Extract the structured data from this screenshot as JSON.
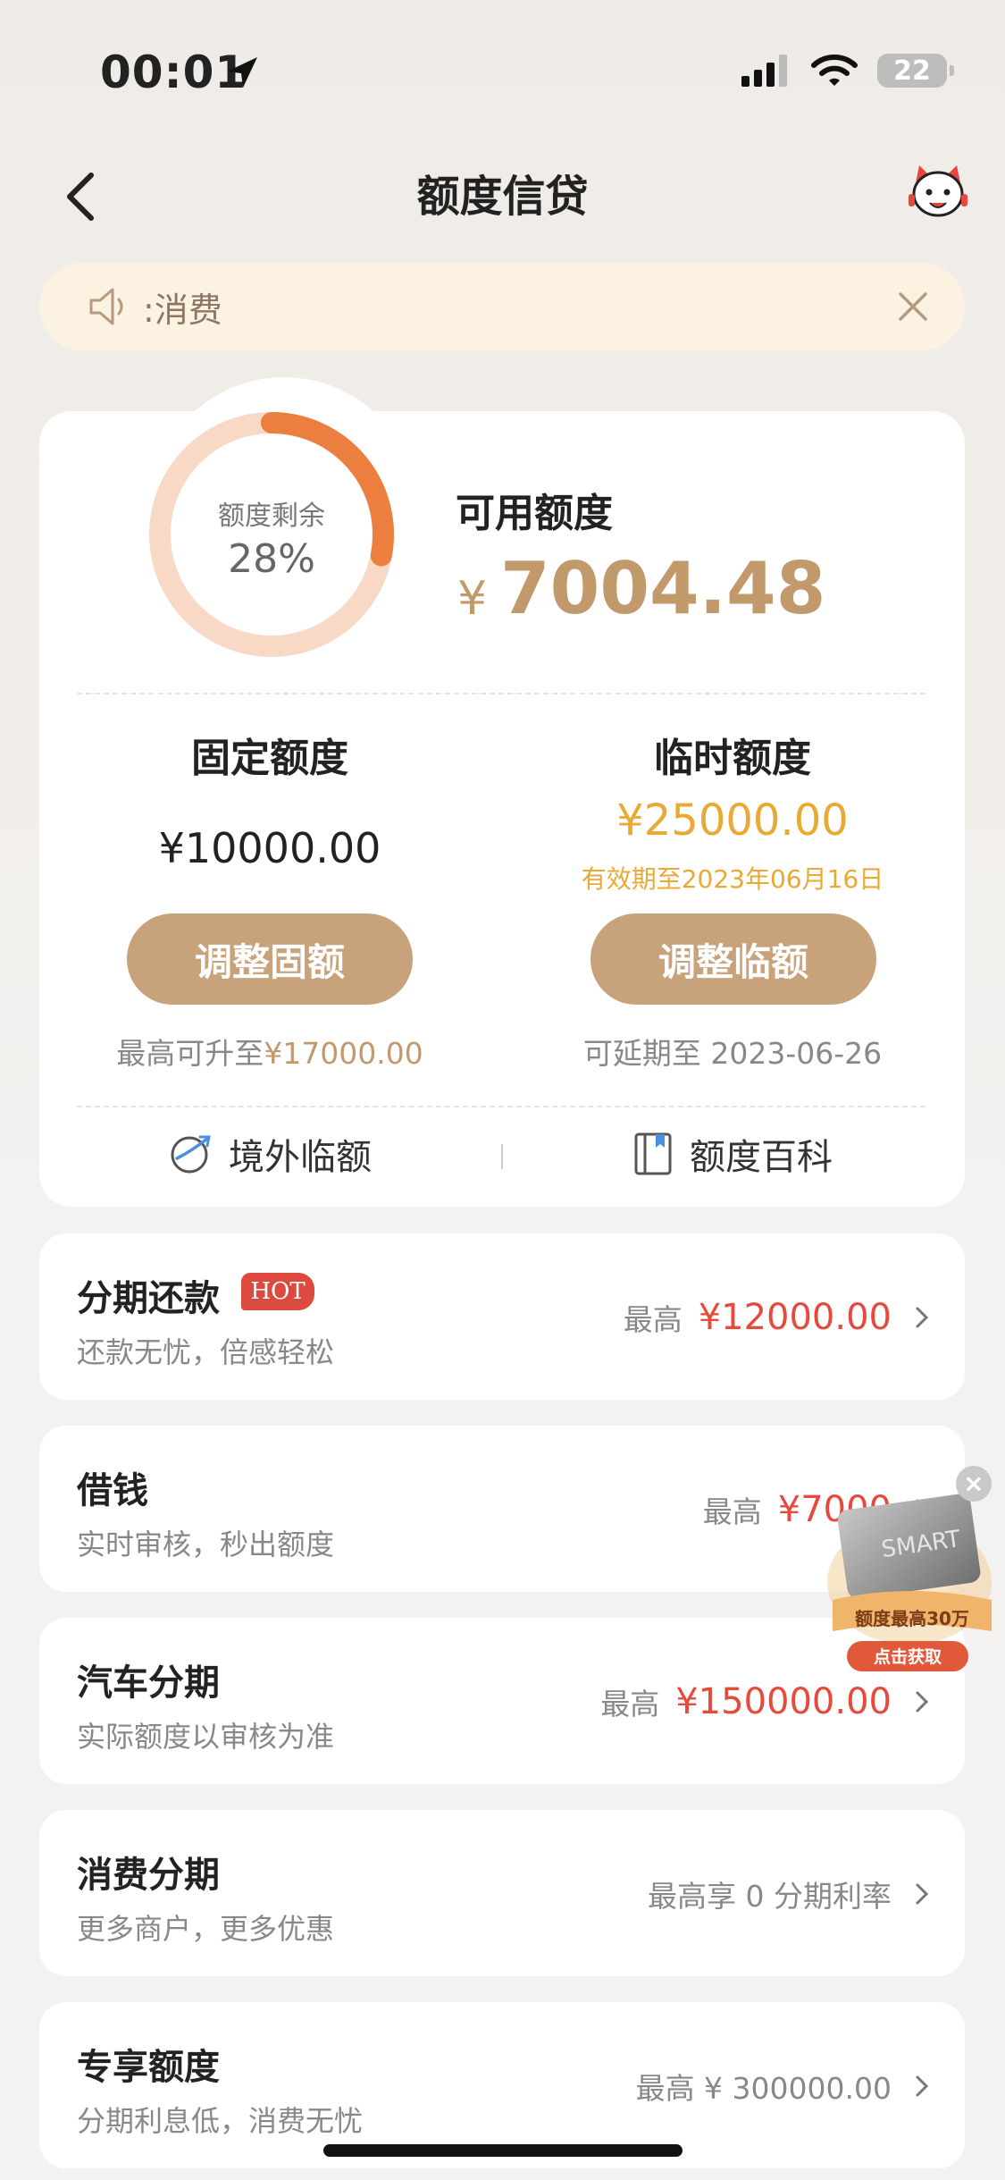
{
  "status_bar": {
    "time": "00:01",
    "battery": "22"
  },
  "nav": {
    "title": "额度信贷"
  },
  "notice": {
    "text": ":消费"
  },
  "summary": {
    "remaining_label": "额度剩余",
    "remaining_pct": "28%",
    "remaining_fraction": 0.28,
    "available_label": "可用额度",
    "available_currency": "¥",
    "available_amount": "7004.48"
  },
  "fixed": {
    "title": "固定额度",
    "amount": "¥10000.00",
    "button": "调整固额",
    "note_prefix": "最高可升至",
    "note_value": "¥17000.00"
  },
  "temporary": {
    "title": "临时额度",
    "amount": "¥25000.00",
    "expiry": "有效期至2023年06月16日",
    "button": "调整临额",
    "note": "可延期至 2023-06-26"
  },
  "links": {
    "overseas": "境外临额",
    "wiki": "额度百科"
  },
  "items": [
    {
      "name": "分期还款",
      "badge": "HOT",
      "sub": "还款无忧，倍感轻松",
      "prefix": "最高",
      "value": "¥12000.00"
    },
    {
      "name": "借钱",
      "sub": "实时审核，秒出额度",
      "prefix": "最高",
      "value": "¥7000"
    },
    {
      "name": "汽车分期",
      "sub": "实际额度以审核为准",
      "prefix": "最高",
      "value": "¥150000.00"
    },
    {
      "name": "消费分期",
      "sub": "更多商户，更多优惠",
      "value": "最高享 0 分期利率"
    },
    {
      "name": "专享额度",
      "sub": "分期利息低，消费无忧",
      "value": "最高 ¥ 300000.00"
    }
  ],
  "ad": {
    "headline": "额度最高30万",
    "cta": "点击获取",
    "card_text": "SMART"
  },
  "colors": {
    "accent": "#c7a27b",
    "gold_text": "#c1996b",
    "orange": "#e9a935",
    "red": "#e54a3c",
    "ring": "#ec7f3f",
    "ring_track": "#f7d9c6"
  }
}
